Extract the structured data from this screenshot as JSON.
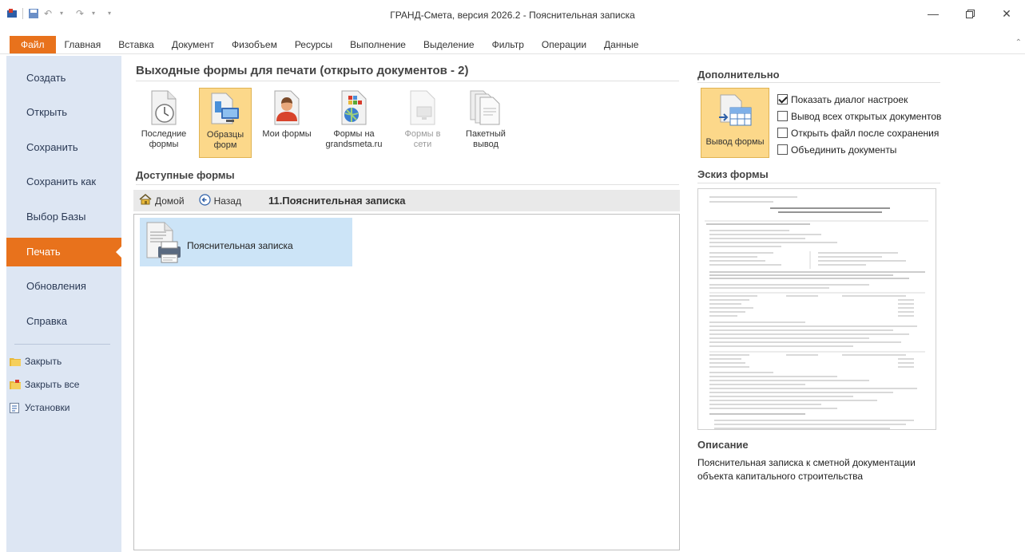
{
  "window": {
    "title": "ГРАНД-Смета, версия 2026.2 - Пояснительная записка"
  },
  "ribbon": {
    "tabs": [
      {
        "label": "Файл",
        "active": true
      },
      {
        "label": "Главная"
      },
      {
        "label": "Вставка"
      },
      {
        "label": "Документ"
      },
      {
        "label": "Физобъем"
      },
      {
        "label": "Ресурсы"
      },
      {
        "label": "Выполнение"
      },
      {
        "label": "Выделение"
      },
      {
        "label": "Фильтр"
      },
      {
        "label": "Операции"
      },
      {
        "label": "Данные"
      }
    ]
  },
  "backstage_nav": {
    "items": [
      {
        "label": "Создать"
      },
      {
        "label": "Открыть"
      },
      {
        "label": "Сохранить"
      },
      {
        "label": "Сохранить как"
      },
      {
        "label": "Выбор Базы"
      },
      {
        "label": "Печать",
        "active": true
      },
      {
        "label": "Обновления"
      },
      {
        "label": "Справка"
      }
    ],
    "sub_items": [
      {
        "label": "Закрыть",
        "icon": "folder-close-icon"
      },
      {
        "label": "Закрыть все",
        "icon": "folder-close-all-icon"
      },
      {
        "label": "Установки",
        "icon": "settings-page-icon"
      }
    ]
  },
  "main": {
    "title": "Выходные формы для печати (открыто документов - 2)",
    "gallery": [
      {
        "label": "Последние формы",
        "icon": "clock-document-icon"
      },
      {
        "label": "Образцы форм",
        "icon": "sample-forms-icon",
        "active": true
      },
      {
        "label": "Мои формы",
        "icon": "user-document-icon"
      },
      {
        "label": "Формы на grandsmeta.ru",
        "icon": "web-forms-icon"
      },
      {
        "label": "Формы в сети",
        "icon": "network-forms-icon",
        "disabled": true
      },
      {
        "label": "Пакетный вывод",
        "icon": "batch-output-icon"
      }
    ],
    "available_title": "Доступные формы",
    "breadcrumb": {
      "home": "Домой",
      "back": "Назад",
      "path": "11.Пояснительная записка"
    },
    "files": [
      {
        "name": "Пояснительная записка",
        "selected": true
      }
    ]
  },
  "right_panel": {
    "extra_title": "Дополнительно",
    "output_button": "Вывод формы",
    "options": [
      {
        "label": "Показать диалог настроек",
        "checked": true
      },
      {
        "label": "Вывод всех открытых документов",
        "checked": false
      },
      {
        "label": "Открыть файл после сохранения",
        "checked": false
      },
      {
        "label": "Объединить документы",
        "checked": false
      }
    ],
    "preview_title": "Эскиз формы",
    "description_title": "Описание",
    "description_text": "Пояснительная записка к сметной документации объекта капитального строительства"
  },
  "colors": {
    "accent": "#e8721c",
    "nav_bg": "#dde6f3",
    "highlight": "#fcd88a",
    "selection": "#cce4f7"
  }
}
